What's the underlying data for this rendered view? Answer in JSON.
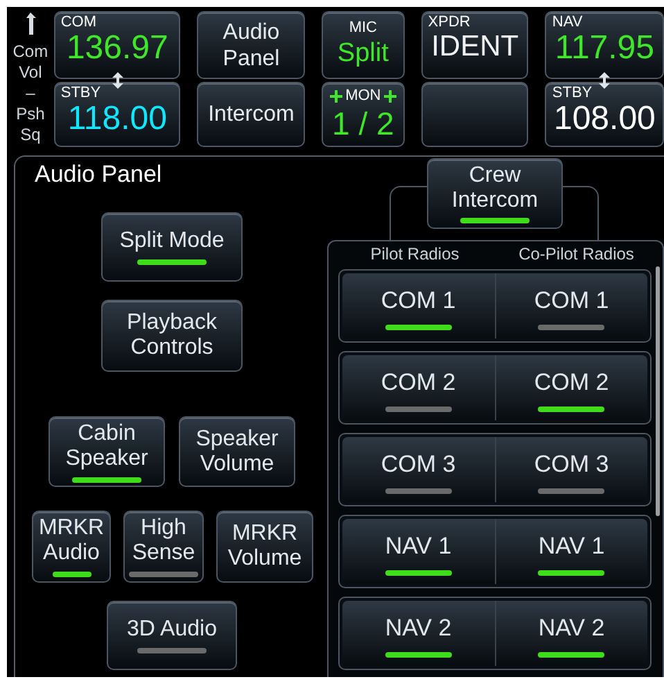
{
  "side_control": {
    "lines": [
      "Com",
      "Vol",
      "–",
      "Psh",
      "Sq"
    ]
  },
  "com": {
    "label": "COM",
    "active": "136.97",
    "standby_label": "STBY",
    "standby": "118.00"
  },
  "top_columns": [
    {
      "top": {
        "kind": "text",
        "text": "Audio Panel"
      },
      "bottom": {
        "kind": "text",
        "text": "Intercom"
      }
    },
    {
      "top": {
        "kind": "mic",
        "label": "MIC",
        "value": "Split"
      },
      "bottom": {
        "kind": "mon",
        "label": "MON",
        "value": "1 / 2"
      }
    },
    {
      "top": {
        "kind": "xpdr",
        "label": "XPDR",
        "value": "IDENT"
      },
      "bottom": {
        "kind": "empty"
      }
    }
  ],
  "nav": {
    "label": "NAV",
    "active": "117.95",
    "standby_label": "STBY",
    "standby": "108.00"
  },
  "audio_panel": {
    "title": "Audio Panel",
    "button_rows": [
      [
        {
          "label": "Split Mode",
          "kind": "toggle",
          "on": true
        }
      ],
      [
        {
          "label": "Playback Controls",
          "kind": "plain"
        }
      ],
      [
        {
          "label": "Cabin Speaker",
          "kind": "toggle",
          "on": true
        },
        {
          "label": "Speaker Volume",
          "kind": "plain"
        }
      ],
      [
        {
          "label": "MRKR Audio",
          "kind": "toggle",
          "on": true
        },
        {
          "label": "High Sense",
          "kind": "toggle",
          "on": false
        },
        {
          "label": "MRKR Volume",
          "kind": "plain"
        }
      ],
      [
        {
          "label": "3D Audio",
          "kind": "toggle",
          "on": false
        }
      ]
    ],
    "crew_intercom": {
      "label": "Crew Intercom",
      "on": true
    },
    "radios": {
      "columns": [
        "Pilot Radios",
        "Co-Pilot Radios"
      ],
      "rows": [
        {
          "pilot": {
            "label": "COM 1",
            "on": true
          },
          "copilot": {
            "label": "COM 1",
            "on": false
          }
        },
        {
          "pilot": {
            "label": "COM 2",
            "on": false
          },
          "copilot": {
            "label": "COM 2",
            "on": true
          }
        },
        {
          "pilot": {
            "label": "COM 3",
            "on": false
          },
          "copilot": {
            "label": "COM 3",
            "on": false
          }
        },
        {
          "pilot": {
            "label": "NAV 1",
            "on": true
          },
          "copilot": {
            "label": "NAV 1",
            "on": true
          }
        },
        {
          "pilot": {
            "label": "NAV 2",
            "on": true
          },
          "copilot": {
            "label": "NAV 2",
            "on": true
          }
        }
      ]
    }
  }
}
